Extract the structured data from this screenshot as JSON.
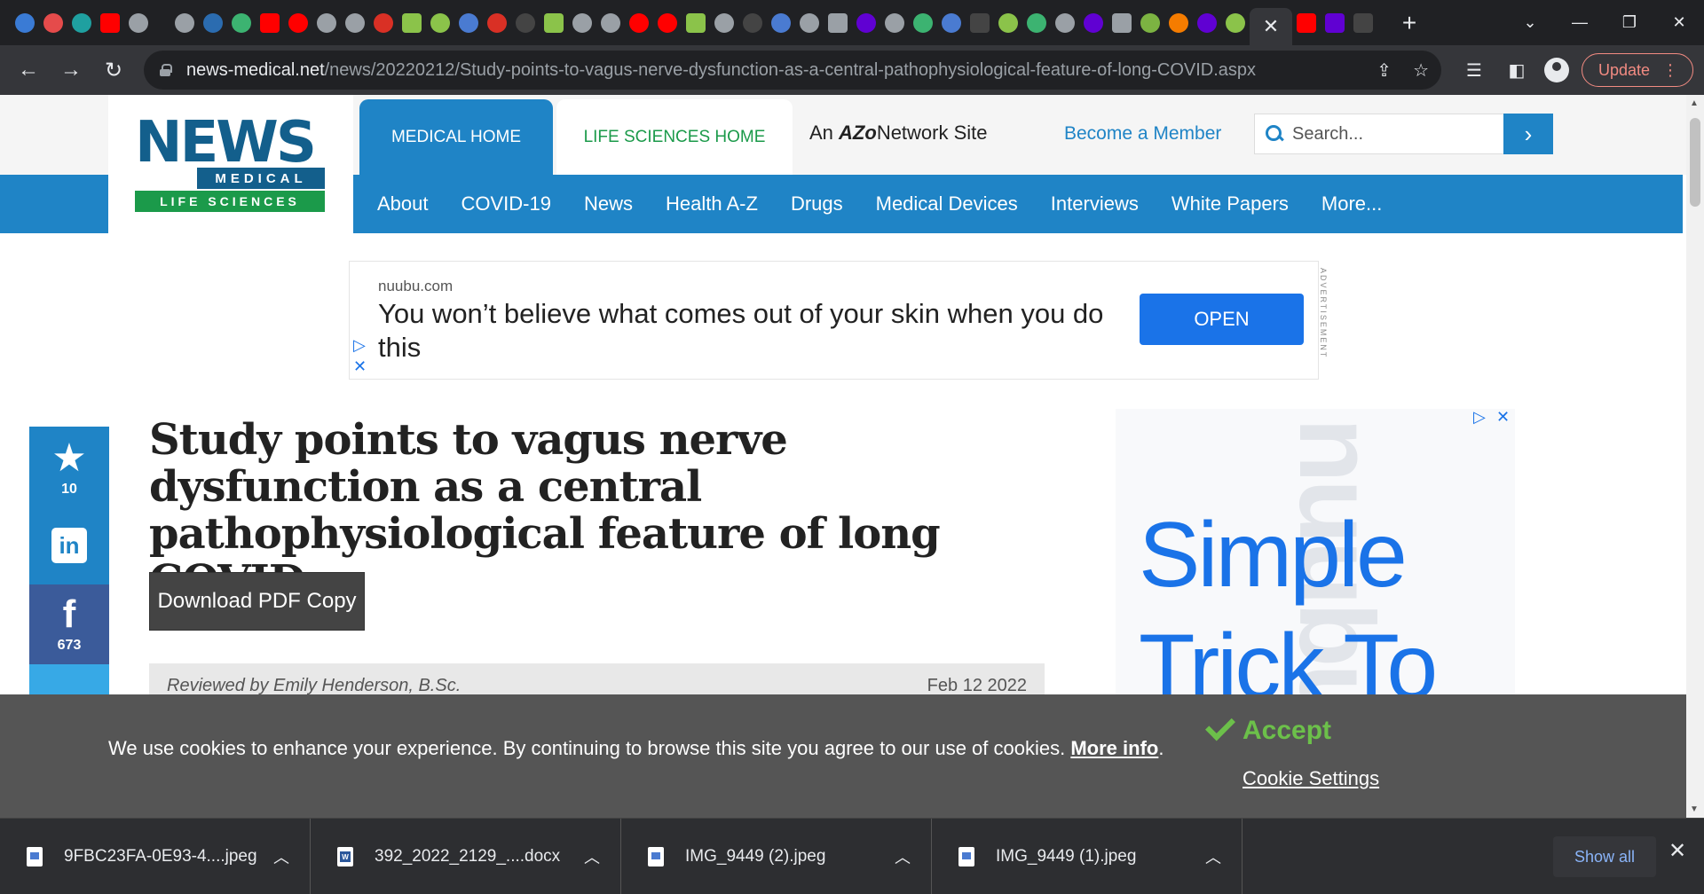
{
  "browser": {
    "url_host": "news-medical.net",
    "url_path": "/news/20220212/Study-points-to-vagus-nerve-dysfunction-as-a-central-pathophysiological-feature-of-long-COVID.aspx",
    "update_label": "Update",
    "active_tab_close": "✕",
    "new_tab": "+",
    "tab_favicons": [
      "#3a7bd5",
      "#e54b4b",
      "#1fa0a0",
      "#ff0000",
      "#9aa0a6",
      "#9aa0a6",
      "#2b6cb0",
      "#3cb371",
      "#ff0000",
      "#ff0000",
      "#9aa0a6",
      "#9aa0a6",
      "#d93025",
      "#8bc34a",
      "#8bc34a",
      "#4a7bd1",
      "#d93025",
      "#444",
      "#8bc34a",
      "#9aa0a6",
      "#9aa0a6",
      "#ff0000",
      "#ff0000",
      "#8bc34a",
      "#9aa0a6",
      "#444",
      "#4a7bd1",
      "#9aa0a6",
      "#9aa0a6",
      "#6001d2",
      "#9aa0a6",
      "#3cb371",
      "#4a7bd1",
      "#444",
      "#8bc34a",
      "#3cb371",
      "#9aa0a6",
      "#6001d2",
      "#9aa0a6",
      "#7cb342",
      "#f57c00",
      "#6001d2",
      "#8bc34a"
    ],
    "tab_favicons_after_active": [
      "#ff0000",
      "#6001d2",
      "#444"
    ]
  },
  "site": {
    "logo_news": "NEWS",
    "logo_medical": "MEDICAL",
    "logo_life_sciences": "LIFE SCIENCES",
    "tab_medical_home": "MEDICAL HOME",
    "tab_life_sciences_home": "LIFE SCIENCES HOME",
    "azo_prefix": "An",
    "azo_brand": "AZo",
    "azo_suffix": "Network  Site",
    "become_member": "Become a Member",
    "search_placeholder": "Search...",
    "search_go": "›",
    "nav": [
      "About",
      "COVID-19",
      "News",
      "Health A-Z",
      "Drugs",
      "Medical Devices",
      "Interviews",
      "White Papers",
      "More..."
    ]
  },
  "ad_banner": {
    "domain": "nuubu.com",
    "text": "You won’t believe what comes out of your skin when you do this",
    "cta": "OPEN",
    "label": "ADVERTISEMENT"
  },
  "share": {
    "star_count": "10",
    "linkedin": "in",
    "facebook": "f",
    "facebook_count": "673"
  },
  "article": {
    "title": "Study points to vagus nerve dysfunction as a central pathophysiological feature of long COVID",
    "pdf_button": "Download PDF Copy",
    "reviewed_by": "Reviewed by Emily Henderson, B.Sc.",
    "date": "Feb 12 2022"
  },
  "side_ad": {
    "headline": "Simple\nTrick To",
    "background_brand": "nuubu"
  },
  "cookie": {
    "message": "We use cookies to enhance your experience. By continuing to browse this site you agree to our use of cookies.",
    "more_info": "More info",
    "period": ".",
    "accept": "Accept",
    "settings": "Cookie Settings"
  },
  "downloads": {
    "items": [
      {
        "name": "9FBC23FA-0E93-4....jpeg",
        "kind": "image"
      },
      {
        "name": "392_2022_2129_....docx",
        "kind": "doc"
      },
      {
        "name": "IMG_9449 (2).jpeg",
        "kind": "image"
      },
      {
        "name": "IMG_9449 (1).jpeg",
        "kind": "image"
      }
    ],
    "show_all": "Show all",
    "close": "✕"
  }
}
